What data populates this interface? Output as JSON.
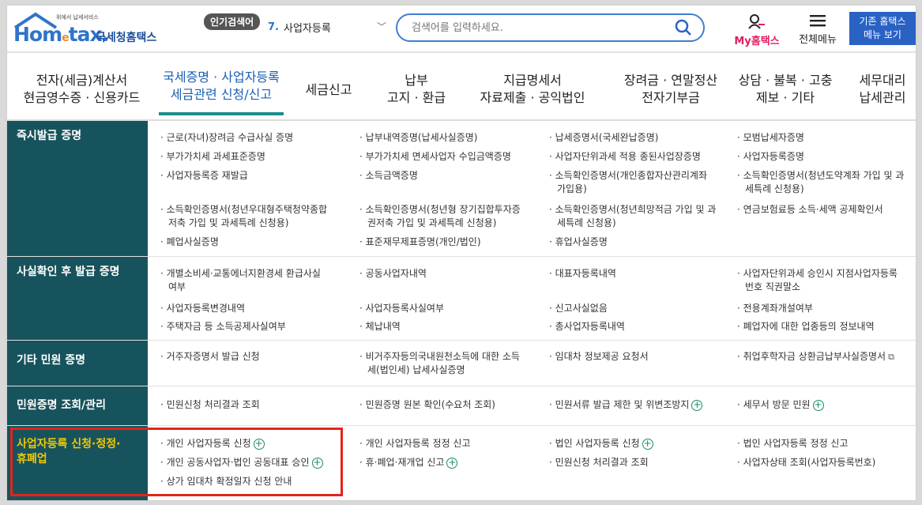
{
  "logo": {
    "small": "위에서 납세서비스",
    "brand": "Hom tax.",
    "brand_home": "Hom",
    "brand_e": "e",
    "brand_tax": "tax.",
    "kr": "국세청홈택스"
  },
  "popular": {
    "badge": "인기검색어",
    "rank": "7.",
    "term": "사업자등록"
  },
  "search": {
    "placeholder": "검색어를 입력하세요."
  },
  "topright": {
    "my": "My홈택스",
    "menu": "전체메뉴",
    "classic_line1": "기존 홈택스",
    "classic_line2": "메뉴 보기"
  },
  "nav": [
    {
      "l1": "전자(세금)계산서",
      "l2": "현금영수증 · 신용카드"
    },
    {
      "l1": "국세증명 · 사업자등록",
      "l2": "세금관련 신청/신고"
    },
    {
      "l1": "세금신고",
      "l2": ""
    },
    {
      "l1": "납부",
      "l2": "고지 · 환급"
    },
    {
      "l1": "지급명세서",
      "l2": "자료제출 · 공익법인"
    },
    {
      "l1": "장려금 · 연말정산",
      "l2": "전자기부금"
    },
    {
      "l1": "상담 · 불복 · 고충",
      "l2": "제보 · 기타"
    },
    {
      "l1": "세무대리",
      "l2": "납세관리"
    }
  ],
  "sections": [
    {
      "title": "즉시발급 증명",
      "items": [
        "· 근로(자녀)장려금 수급사실 증명",
        "· 납부내역증명(납세사실증명)",
        "· 납세증명서(국세완납증명)",
        "· 모범납세자증명",
        "· 부가가치세 과세표준증명",
        "· 부가가치세 면세사업자 수입금액증명",
        "· 사업자단위과세 적용 종된사업장증명",
        "· 사업자등록증명",
        "· 사업자등록증 재발급",
        "· 소득금액증명",
        "· 소득확인증명서(개인종합자산관리계좌",
        "가입용)",
        "· 소득확인증명서(청년도약계좌 가입 및 과",
        "세특례 신청용)",
        "· 소득확인증명서(청년우대형주택청약종합",
        "저축 가입 및 과세특례 신청용)",
        "· 소득확인증명서(청년형 장기집합투자증",
        "권저축 가입 및 과세특례 신청용)",
        "· 소득확인증명서(청년희망적금 가입 및 과",
        "세특례 신청용)",
        "· 연금보험료등 소득·세액 공제확인서",
        "· 폐업사실증명",
        "· 표준재무제표증명(개인/법인)",
        "· 휴업사실증명"
      ]
    },
    {
      "title": "사실확인 후 발급 증명",
      "items": [
        "· 개별소비세·교통에너지환경세 환급사실",
        "여부",
        "· 공동사업자내역",
        "· 대표자등록내역",
        "· 사업자단위과세 승인시 지점사업자등록",
        "번호 직권말소",
        "· 사업자등록변경내역",
        "· 사업자등록사실여부",
        "· 신고사실없음",
        "· 전용계좌개설여부",
        "· 주택자금 등 소득공제사실여부",
        "· 체납내역",
        "· 총사업자등록내역",
        "· 폐업자에 대한 업종등의 정보내역"
      ]
    },
    {
      "title": "기타 민원 증명",
      "items": [
        "· 거주자증명서 발급 신청",
        "· 비거주자등의국내원천소득에 대한 소득",
        "세(법인세) 납세사실증명",
        "· 임대차 정보제공 요청서",
        "· 취업후학자금 상환금납부사실증명서"
      ]
    },
    {
      "title": "민원증명 조회/관리",
      "items": [
        "· 민원신청 처리결과 조회",
        "· 민원증명 원본 확인(수요처 조회)",
        "· 민원서류 발급 제한 및 위변조방지",
        "· 세무서 방문 민원"
      ]
    },
    {
      "title_l1": "사업자등록 신청·정정·",
      "title_l2": "휴폐업",
      "items": [
        "· 개인 사업자등록 신청",
        "· 개인 사업자등록 정정 신고",
        "· 법인 사업자등록 신청",
        "· 법인 사업자등록 정정 신고",
        "· 개인 공동사업자·법인 공동대표 승인",
        "· 휴·폐업·재개업 신고",
        "· 민원신청 처리결과 조회",
        "· 사업자상태 조회(사업자등록번호)",
        "· 상가 임대차 확정일자 신청 안내"
      ]
    }
  ],
  "colors": {
    "category_bg": "#17535c",
    "highlight_text": "#f5c800",
    "accent_blue": "#2a62c4",
    "red_box": "#e4231b"
  }
}
